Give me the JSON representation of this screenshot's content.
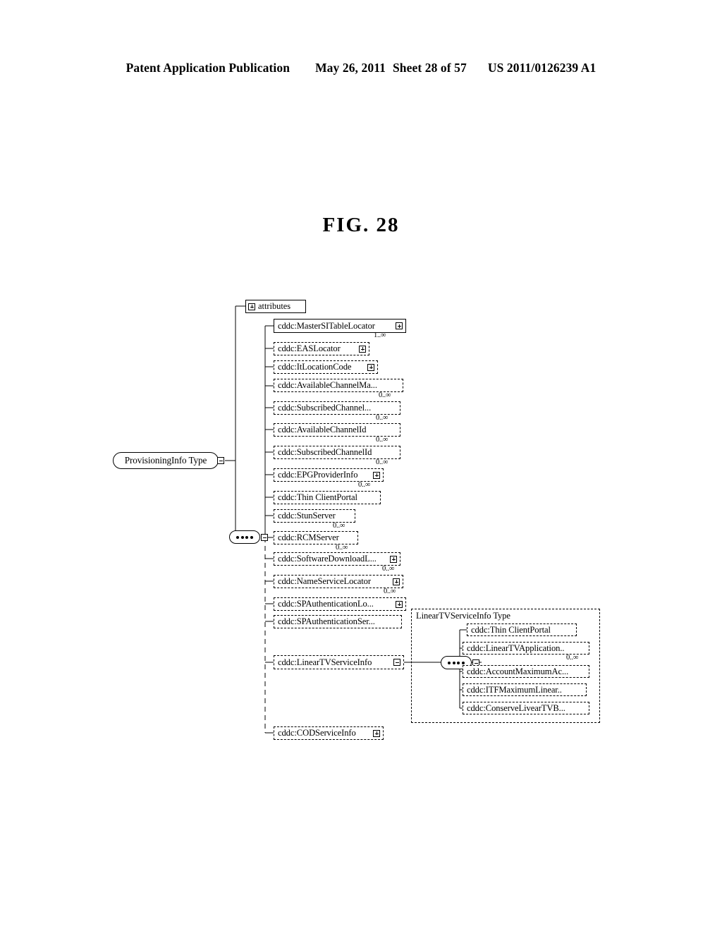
{
  "header": {
    "publication": "Patent Application Publication",
    "date": "May 26, 2011",
    "sheet": "Sheet 28 of 57",
    "number": "US 2011/0126239 A1"
  },
  "figure": {
    "title": "FIG. 28"
  },
  "diagram": {
    "type": "xml-schema-tree",
    "root": {
      "label": "ProvisioningInfo Type",
      "collapse_marker": "minus"
    },
    "attributes_node": {
      "label": "attributes",
      "expand_marker": "plus"
    },
    "sequence_node": {
      "label": "sequence",
      "dots": 4,
      "collapse_marker": "minus"
    },
    "elements": [
      {
        "label": "cddc:MasterSITableLocator",
        "border": "solid",
        "cardinality": "1..∞",
        "expander": "plus"
      },
      {
        "label": "cddc:EASLocator",
        "border": "dashed",
        "cardinality": "",
        "expander": "plus"
      },
      {
        "label": "cddc:ItLocationCode",
        "border": "dashed",
        "cardinality": "",
        "expander": "plus"
      },
      {
        "label": "cddc:AvailableChannelMa...",
        "border": "dashed",
        "cardinality": "0..∞",
        "expander": "none"
      },
      {
        "label": "cddc:SubscribedChannel...",
        "border": "dashed",
        "cardinality": "0..∞",
        "expander": "none"
      },
      {
        "label": "cddc:AvailableChannelId",
        "border": "dashed",
        "cardinality": "0..∞",
        "expander": "none"
      },
      {
        "label": "cddc:SubscribedChannelId",
        "border": "dashed",
        "cardinality": "0..∞",
        "expander": "none"
      },
      {
        "label": "cddc:EPGProviderInfo",
        "border": "dashed",
        "cardinality": "0..∞",
        "expander": "plus"
      },
      {
        "label": "cddc:Thin ClientPortal",
        "border": "dashed",
        "cardinality": "",
        "expander": "none"
      },
      {
        "label": "cddc:StunServer",
        "border": "dashed",
        "cardinality": "0..∞",
        "expander": "none"
      },
      {
        "label": "cddc:RCMServer",
        "border": "dashed",
        "cardinality": "0..∞",
        "expander": "none"
      },
      {
        "label": "cddc:SoftwareDownloadL...",
        "border": "dashed",
        "cardinality": "0..∞",
        "expander": "plus"
      },
      {
        "label": "cddc:NameServiceLocator",
        "border": "dashed",
        "cardinality": "0..∞",
        "expander": "plus"
      },
      {
        "label": "cddc:SPAuthenticationLo...",
        "border": "dashed",
        "cardinality": "",
        "expander": "plus"
      },
      {
        "label": "cddc:SPAuthenticationSer...",
        "border": "dashed",
        "cardinality": "",
        "expander": "none"
      },
      {
        "label": "cddc:LinearTVServiceInfo",
        "border": "dashed",
        "cardinality": "",
        "expander": "minus"
      },
      {
        "label": "cddc:CODServiceInfo",
        "border": "dashed",
        "cardinality": "",
        "expander": "plus"
      }
    ],
    "lineartv_subtree": {
      "container_label": "LinearTVServiceInfo Type",
      "sequence_node": {
        "label": "sequence",
        "dots": 4,
        "collapse_marker": "minus"
      },
      "elements": [
        {
          "label": "cddc:Thin ClientPortal",
          "border": "dashed",
          "cardinality": ""
        },
        {
          "label": "cddc:LinearTVApplication..",
          "border": "dashed",
          "cardinality": "0..∞"
        },
        {
          "label": "cddc:AccountMaximumAc...",
          "border": "dashed",
          "cardinality": ""
        },
        {
          "label": "cddc:ITFMaximumLinear..",
          "border": "dashed",
          "cardinality": ""
        },
        {
          "label": "cddc:ConserveLivearTVB...",
          "border": "dashed",
          "cardinality": ""
        }
      ]
    }
  }
}
